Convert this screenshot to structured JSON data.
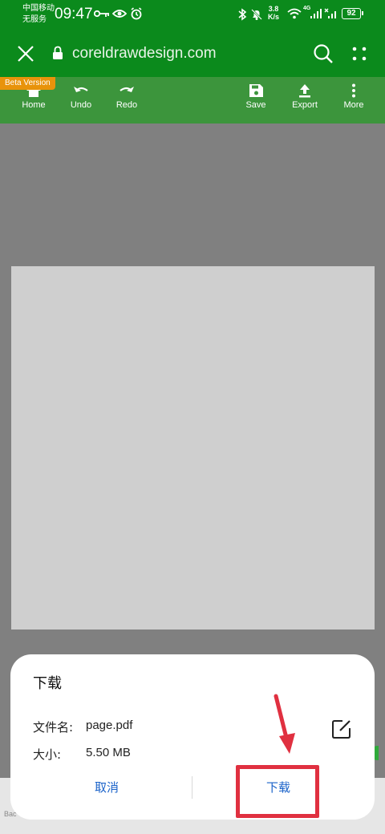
{
  "status_bar": {
    "carrier_line1": "中国移动",
    "carrier_line2": "无服务",
    "time": "09:47",
    "speed_value": "3.8",
    "speed_unit": "K/s",
    "network": "4G",
    "battery": "92"
  },
  "browser": {
    "url": "coreldrawdesign.com"
  },
  "toolbar": {
    "beta_badge": "Beta Version",
    "home": "Home",
    "undo": "Undo",
    "redo": "Redo",
    "save": "Save",
    "export": "Export",
    "more": "More"
  },
  "bottom": {
    "hint": "Bac"
  },
  "dialog": {
    "title": "下载",
    "filename_label": "文件名:",
    "filename_value": "page.pdf",
    "size_label": "大小:",
    "size_value": "5.50 MB",
    "cancel_label": "取消",
    "download_label": "下载"
  },
  "colors": {
    "header_green": "#0b8a1c",
    "toolbar_green": "#3c953c",
    "beta_orange": "#e8930b",
    "accent_blue": "#1a62c9",
    "annotation_red": "#e03040"
  }
}
